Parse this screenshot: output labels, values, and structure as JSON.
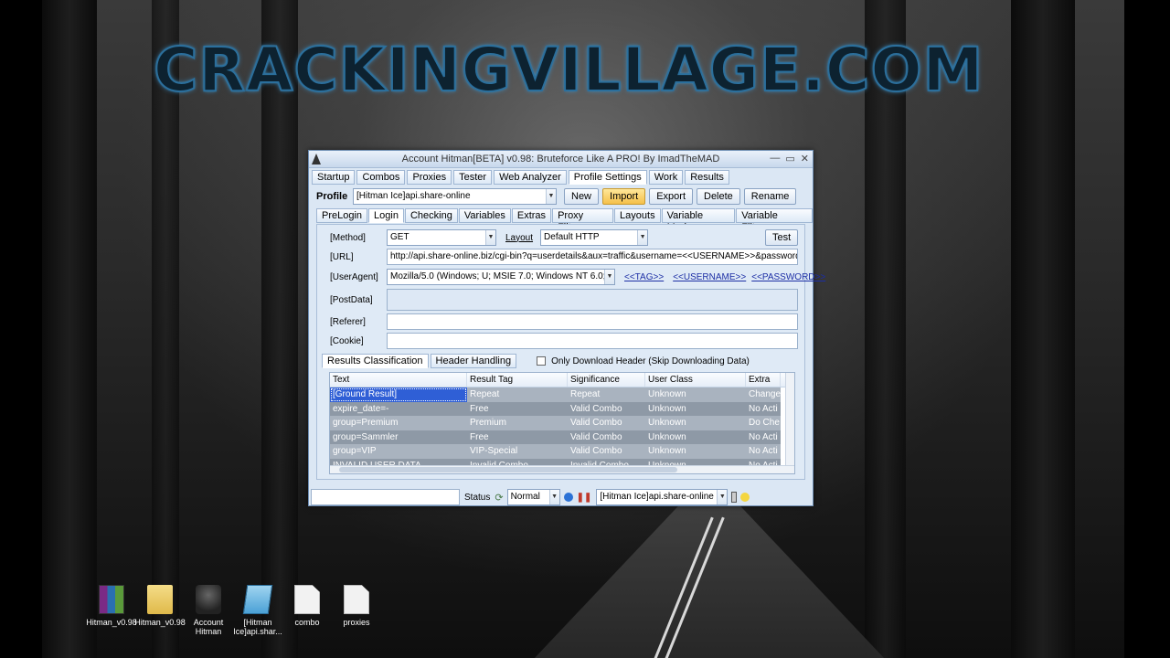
{
  "brand": "CRACKINGVILLAGE.COM",
  "window": {
    "title": "Account Hitman[BETA] v0.98: Bruteforce Like A PRO!  By ImadTheMAD",
    "controls": {
      "minimize": "—",
      "maximize": "▭",
      "close": "✕"
    }
  },
  "menu": [
    "Startup",
    "Combos",
    "Proxies",
    "Tester",
    "Web Analyzer",
    "Profile Settings",
    "Work",
    "Results"
  ],
  "profile": {
    "label": "Profile",
    "value": "[Hitman Ice]api.share-online",
    "buttons": {
      "new": "New",
      "import": "Import",
      "export": "Export",
      "delete": "Delete",
      "rename": "Rename"
    }
  },
  "subtabs": [
    "PreLogin",
    "Login",
    "Checking",
    "Variables",
    "Extras",
    "Proxy Filter",
    "Layouts",
    "Variable Mods",
    "Variable Filters"
  ],
  "login": {
    "method_label": "[Method]",
    "method_value": "GET",
    "layout_label": "Layout",
    "layout_value": "Default HTTP",
    "test_button": "Test",
    "url_label": "[URL]",
    "url_value": "http://api.share-online.biz/cgi-bin?q=userdetails&aux=traffic&username=<<USERNAME>>&password",
    "useragent_label": "[UserAgent]",
    "useragent_value": "Mozilla/5.0 (Windows; U; MSIE 7.0; Windows NT 6.0; e",
    "tag_links": [
      "<<TAG>>",
      "<<USERNAME>>",
      "<<PASSWORD>>"
    ],
    "postdata_label": "[PostData]",
    "postdata_value": "",
    "referer_label": "[Referer]",
    "referer_value": "",
    "cookie_label": "[Cookie]",
    "cookie_value": ""
  },
  "results": {
    "tabs": [
      "Results Classification",
      "Header Handling"
    ],
    "only_header_label": "Only Download Header (Skip Downloading Data)",
    "columns": [
      "Text",
      "Result Tag",
      "Significance",
      "User Class",
      "Extra Ac"
    ],
    "rows": [
      [
        "[Ground Result]",
        "Repeat",
        "Repeat",
        "Unknown",
        "Change"
      ],
      [
        "expire_date=-",
        "Free",
        "Valid Combo",
        "Unknown",
        "No Acti"
      ],
      [
        "group=Premium",
        "Premium",
        "Valid Combo",
        "Unknown",
        "Do Che"
      ],
      [
        "group=Sammler",
        "Free",
        "Valid Combo",
        "Unknown",
        "No Acti"
      ],
      [
        "group=VIP",
        "VIP-Special",
        "Valid Combo",
        "Unknown",
        "No Acti"
      ],
      [
        "INVALID USER DATA",
        "Invalid Combo",
        "Invalid Combo",
        "Unknown",
        "No Acti"
      ]
    ]
  },
  "statusbar": {
    "status_label": "Status",
    "mode_value": "Normal",
    "profile_value": "[Hitman Ice]api.share-online"
  },
  "desktop_icons": [
    {
      "label": "Hitman_v0.98",
      "icon": "winrar-archive-icon"
    },
    {
      "label": "Hitman_v0.98",
      "icon": "folder-icon"
    },
    {
      "label": "Account Hitman",
      "icon": "app-icon"
    },
    {
      "label": "[Hitman Ice]api.shar...",
      "icon": "notepad-icon"
    },
    {
      "label": "combo",
      "icon": "text-file-icon"
    },
    {
      "label": "proxies",
      "icon": "text-file-icon"
    }
  ]
}
